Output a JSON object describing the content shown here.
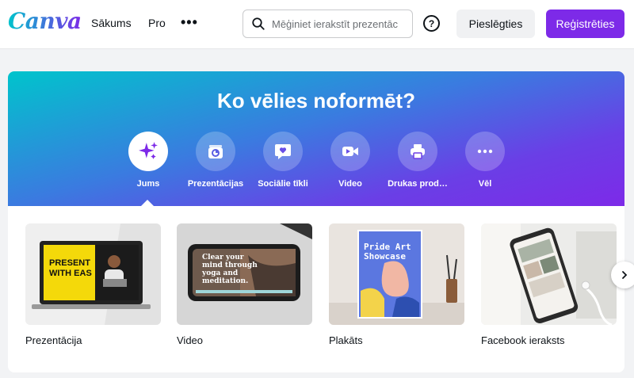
{
  "header": {
    "logo": "Canva",
    "nav": [
      {
        "label": "Sākums"
      },
      {
        "label": "Pro"
      }
    ],
    "more": "•••",
    "search": {
      "placeholder": "Mēģiniet ierakstīt prezentāc"
    },
    "help": "?",
    "login_label": "Pieslēgties",
    "signup_label": "Reģistrēties"
  },
  "hero": {
    "title": "Ko vēlies noformēt?",
    "categories": [
      {
        "label": "Jums",
        "icon": "sparkle-icon",
        "active": true
      },
      {
        "label": "Prezentācijas",
        "icon": "presentation-icon"
      },
      {
        "label": "Sociālie tīkli",
        "icon": "heart-chat-icon"
      },
      {
        "label": "Video",
        "icon": "video-camera-icon"
      },
      {
        "label": "Drukas prod…",
        "icon": "printer-icon"
      },
      {
        "label": "Vēl",
        "icon": "more-icon"
      }
    ]
  },
  "cards": [
    {
      "label": "Prezentācija",
      "thumb_text": [
        "PRESENT",
        "WITH EAS"
      ]
    },
    {
      "label": "Video",
      "thumb_text": [
        "Clear your",
        "mind through",
        "yoga and",
        "meditation."
      ]
    },
    {
      "label": "Plakāts",
      "thumb_text": [
        "Pride Art",
        "Showcase"
      ]
    },
    {
      "label": "Facebook ieraksts"
    }
  ],
  "colors": {
    "brand_purple": "#7d2ae8",
    "brand_teal": "#00c4cc"
  }
}
